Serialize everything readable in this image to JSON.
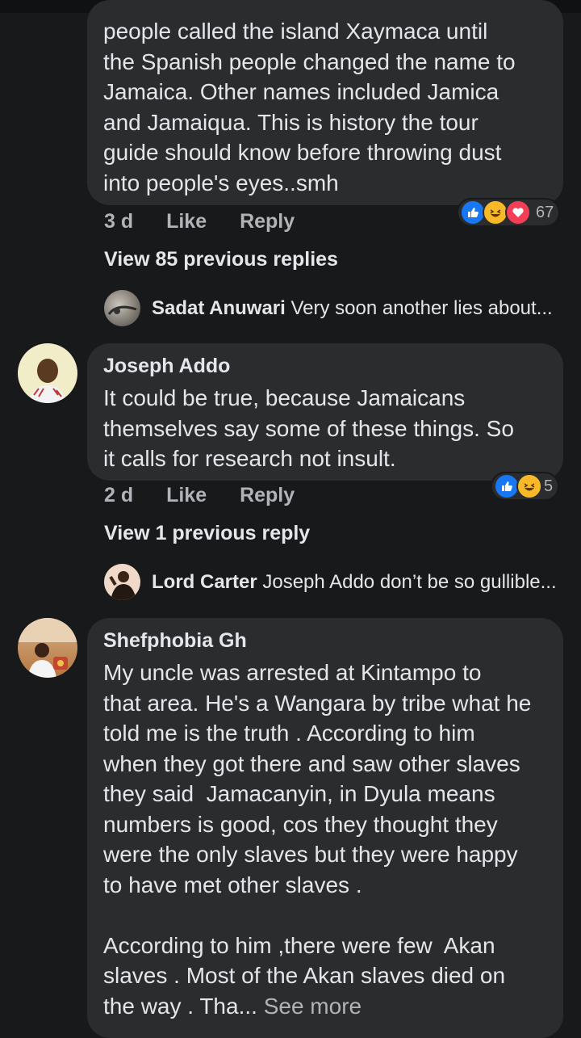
{
  "comment1": {
    "text": "people called the island Xaymaca until\nthe Spanish people changed the name to\nJamaica. Other names included Jamica\nand Jamaiqua. This is history the tour\nguide should know before throwing dust\ninto people's eyes..smh",
    "time": "3 d",
    "like": "Like",
    "reply": "Reply",
    "reaction_count": "67",
    "view_previous": "View 85 previous replies",
    "reply_preview": {
      "author": "Sadat Anuwari",
      "snippet": "Very soon another lies about..."
    }
  },
  "comment2": {
    "author": "Joseph Addo",
    "text": "It could be true, because Jamaicans\nthemselves say some of these things. So\nit calls for research not insult.",
    "time": "2 d",
    "like": "Like",
    "reply": "Reply",
    "reaction_count": "5",
    "view_previous": "View 1 previous reply",
    "reply_preview": {
      "author": "Lord Carter",
      "snippet": "Joseph Addo don’t be so gullible..."
    }
  },
  "comment3": {
    "author": "Shefphobia Gh",
    "text": "My uncle was arrested at Kintampo to\nthat area. He's a Wangara by tribe what he\ntold me is the truth . According to him\nwhen they got there and saw other slaves\nthey said  Jamacanyin, in Dyula means\nnumbers is good, cos they thought they\nwere the only slaves but they were happy\nto have met other slaves .\n\nAccording to him ,there were few  Akan\nslaves . Most of the Akan slaves died on\nthe way . Tha...",
    "see_more": "See more"
  },
  "colors": {
    "background": "#18191a",
    "bubble": "#2b2c2e",
    "like_blue": "#1877f2",
    "haha_yellow": "#f7b928",
    "love_red": "#f33e58"
  }
}
